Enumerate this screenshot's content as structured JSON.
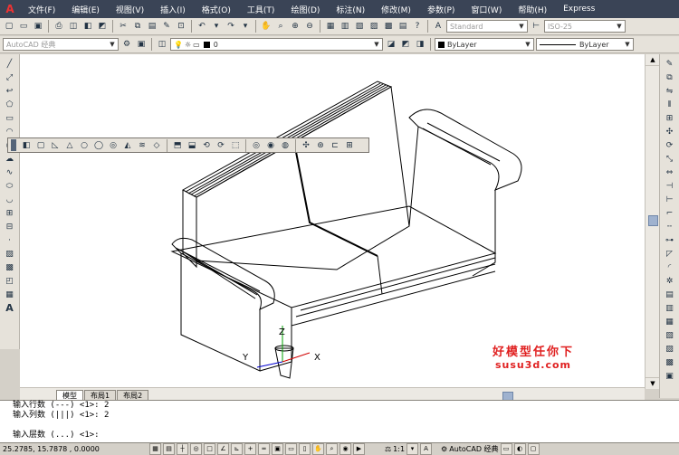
{
  "menu": {
    "items": [
      "文件(F)",
      "编辑(E)",
      "视图(V)",
      "插入(I)",
      "格式(O)",
      "工具(T)",
      "绘图(D)",
      "标注(N)",
      "修改(M)",
      "参数(P)",
      "窗口(W)",
      "帮助(H)",
      "Express"
    ]
  },
  "toolbar1": {
    "text_style": "Standard",
    "dim_style": "ISO-25"
  },
  "toolbar2": {
    "workspace": "AutoCAD 经典",
    "layer": "0",
    "color": "ByLayer",
    "linetype": "ByLayer"
  },
  "layout_tabs": [
    "模型",
    "布局1",
    "布局2"
  ],
  "command_lines": [
    "输入行数 (---) <1>: 2",
    "输入列数 (|||) <1>: 2",
    "",
    "输入层数 (...) <1>:"
  ],
  "status": {
    "coords": "25.2785,  15.7878 , 0.0000",
    "scale": "1:1",
    "workspace": "AutoCAD 经典"
  },
  "watermark": {
    "line1": "好模型任你下",
    "line2": "susu3d.com"
  },
  "ucs": {
    "x": "X",
    "y": "Y",
    "z": "Z"
  }
}
